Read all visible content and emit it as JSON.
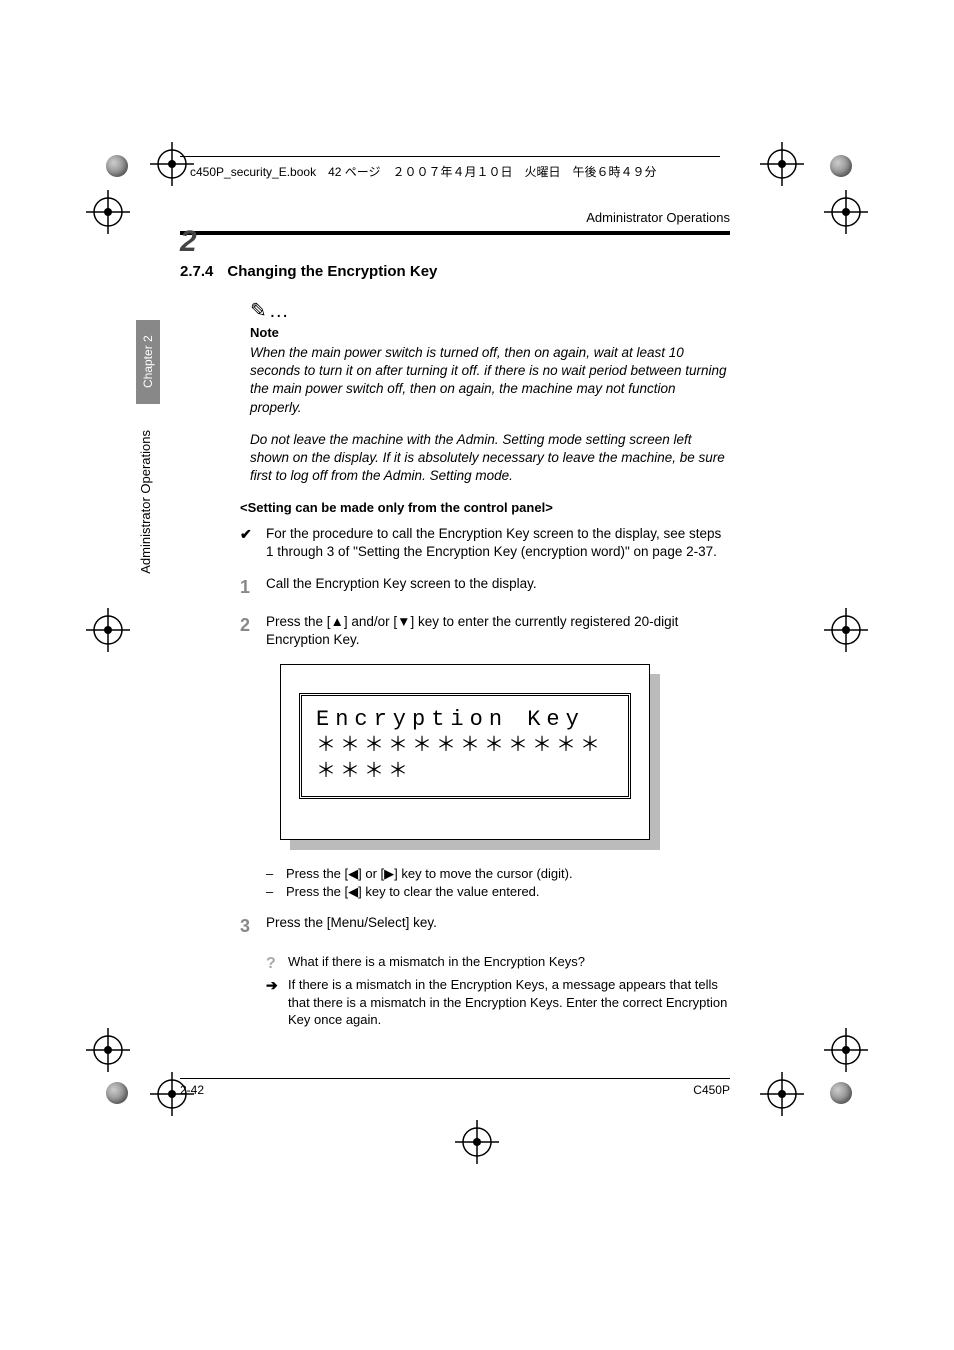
{
  "header": {
    "filetext": "c450P_security_E.book　42 ページ　２００７年４月１０日　火曜日　午後６時４９分",
    "running_head": "Administrator Operations",
    "chapter_num": "2"
  },
  "sidebar": {
    "tab": "Chapter 2",
    "label": "Administrator Operations"
  },
  "section": {
    "num": "2.7.4",
    "title": "Changing the Encryption Key"
  },
  "note": {
    "icon": "✎…",
    "label": "Note",
    "p1": "When the main power switch is turned off, then on again, wait at least 10 seconds to turn it on after turning it off. if there is no wait period between turning the main power switch off, then on again, the machine may not function properly.",
    "p2": "Do not leave the machine with the Admin. Setting mode setting screen left shown on the display. If it is absolutely necessary to leave the machine, be sure first to log off from the Admin. Setting mode."
  },
  "subhead": "<Setting can be made only from the control panel>",
  "steps": {
    "pre": "For the procedure to call the Encryption Key screen to the display, see steps 1 through 3 of \"Setting the Encryption Key (encryption word)\" on page 2-37.",
    "s1": "Call the Encryption Key screen to the display.",
    "s2": "Press the [▲] and/or [▼] key to enter the currently registered 20-digit Encryption Key.",
    "sub1": "Press the [◀] or [▶] key to move the cursor (digit).",
    "sub2": "Press the [◀] key to clear the value entered.",
    "s3": "Press the [Menu/Select] key.",
    "q": "What if there is a mismatch in the Encryption Keys?",
    "a": "If there is a mismatch in the Encryption Keys, a message appears that tells that there is a mismatch in the Encryption Keys. Enter the correct Encryption Key once again."
  },
  "lcd": {
    "line1": "Encryption Key",
    "line2": "＊＊＊＊＊＊＊＊＊＊＊＊＊＊＊＊"
  },
  "markers": {
    "check": "✔",
    "n1": "1",
    "n2": "2",
    "n3": "3",
    "dash": "–",
    "q": "?",
    "arrow": "➔"
  },
  "footer": {
    "left": "2-42",
    "right": "C450P"
  }
}
